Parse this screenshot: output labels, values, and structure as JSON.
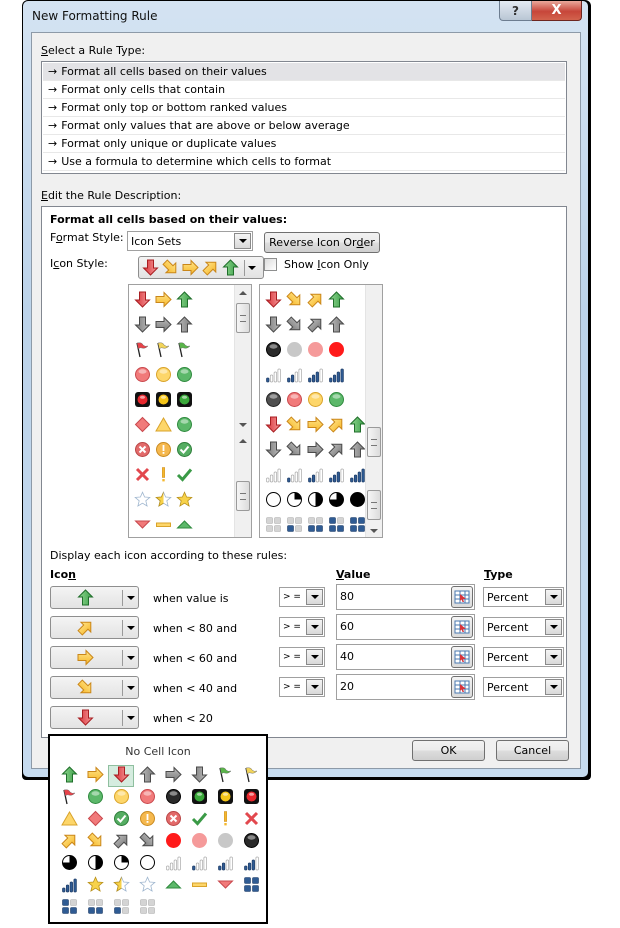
{
  "window": {
    "title": "New Formatting Rule",
    "help_label": "?",
    "close_label": "X"
  },
  "rule_type": {
    "heading_pre": "",
    "heading_u": "S",
    "heading_post": "elect a Rule Type:",
    "bullet": "→",
    "items": [
      {
        "label": "Format all cells based on their values",
        "selected": true
      },
      {
        "label": "Format only cells that contain",
        "selected": false
      },
      {
        "label": "Format only top or bottom ranked values",
        "selected": false
      },
      {
        "label": "Format only values that are above or below average",
        "selected": false
      },
      {
        "label": "Format only unique or duplicate values",
        "selected": false
      },
      {
        "label": "Use a formula to determine which cells to format",
        "selected": false
      }
    ]
  },
  "description": {
    "heading_u": "E",
    "heading_post": "dit the Rule Description:",
    "subheading": "Format all cells based on their values:",
    "format_style_pre": "F",
    "format_style_u": "o",
    "format_style_post": "rmat Style:",
    "format_style_value": "Icon Sets",
    "reverse_pre": "Reverse Icon Or",
    "reverse_u": "d",
    "reverse_post": "er",
    "icon_style_pre": "I",
    "icon_style_u": "c",
    "icon_style_post": "on Style:",
    "icon_style_value": [
      "arrow-down-red",
      "arrow-downright-yellow",
      "arrow-right-yellow",
      "arrow-upright-yellow",
      "arrow-up-green"
    ],
    "show_icon_only_pre": "Show ",
    "show_icon_only_u": "I",
    "show_icon_only_post": "con Only",
    "show_icon_only_checked": false,
    "gallery_left": [
      [
        "arrow-down-red",
        "arrow-right-yellow",
        "arrow-up-green"
      ],
      [
        "arrow-down-gray",
        "arrow-right-gray",
        "arrow-up-gray"
      ],
      [
        "flag-red",
        "flag-yellow",
        "flag-green"
      ],
      [
        "circle-red",
        "circle-yellow",
        "circle-green"
      ],
      [
        "light-red",
        "light-yellow",
        "light-green"
      ],
      [
        "diamond-red",
        "triangle-yellow",
        "circle-green"
      ],
      [
        "symbol-x-red",
        "symbol-excl-yellow",
        "symbol-check-green"
      ],
      [
        "x-red",
        "excl-yellow",
        "check-green"
      ],
      [
        "star-empty",
        "star-half",
        "star-full"
      ],
      [
        "tri-down-red",
        "dash-yellow",
        "tri-up-green"
      ]
    ],
    "gallery_right": [
      [
        "arrow-down-red",
        "arrow-downright-yellow",
        "arrow-upright-yellow",
        "arrow-up-green"
      ],
      [
        "arrow-down-gray",
        "arrow-downright-gray",
        "arrow-upright-gray",
        "arrow-up-gray"
      ],
      [
        "circle-black",
        "circle-gray",
        "circle-pink",
        "circle-brightred"
      ],
      [
        "bars-1",
        "bars-2",
        "bars-3",
        "bars-4"
      ],
      [
        "circle-darkgray",
        "circle-red",
        "circle-yellow",
        "circle-green"
      ],
      [
        "arrow-down-red",
        "arrow-downright-yellow",
        "arrow-right-yellow",
        "arrow-upright-yellow",
        "arrow-up-green"
      ],
      [
        "arrow-down-gray",
        "arrow-downright-gray",
        "arrow-right-gray",
        "arrow-upright-gray",
        "arrow-up-gray"
      ],
      [
        "bars-0",
        "bars-1",
        "bars-2",
        "bars-3",
        "bars-4"
      ],
      [
        "quarter-0",
        "quarter-1",
        "quarter-2",
        "quarter-3",
        "quarter-4"
      ],
      [
        "boxes-0",
        "boxes-1",
        "boxes-2",
        "boxes-3",
        "boxes-4"
      ]
    ],
    "display_rules_label": "Display each icon according to these rules:",
    "col_icon_pre": "Ico",
    "col_icon_u": "n",
    "col_value_u": "V",
    "col_value_post": "alue",
    "col_type_u": "T",
    "col_type_post": "ype",
    "rules": [
      {
        "icon": "arrow-up-green",
        "when": "when value is",
        "operator": ">=",
        "value": "80",
        "type": "Percent"
      },
      {
        "icon": "arrow-upright-yellow",
        "when": "when < 80 and",
        "operator": ">=",
        "value": "60",
        "type": "Percent"
      },
      {
        "icon": "arrow-right-yellow",
        "when": "when < 60 and",
        "operator": ">=",
        "value": "40",
        "type": "Percent"
      },
      {
        "icon": "arrow-downright-yellow",
        "when": "when < 40 and",
        "operator": ">=",
        "value": "20",
        "type": "Percent"
      },
      {
        "icon": "arrow-down-red",
        "when": "when < 20"
      }
    ]
  },
  "buttons": {
    "ok": "OK",
    "cancel": "Cancel"
  },
  "icon_picker": {
    "title": "No Cell Icon",
    "selected_index": 2,
    "icons": [
      "arrow-up-green",
      "arrow-right-yellow",
      "arrow-down-red",
      "arrow-up-gray",
      "arrow-right-gray",
      "arrow-down-gray",
      "flag-green",
      "flag-yellow",
      "flag-red",
      "circle-green",
      "circle-yellow",
      "circle-red",
      "circle-black",
      "light-green",
      "light-yellow",
      "light-red",
      "triangle-yellow",
      "diamond-red",
      "symbol-check-green",
      "symbol-excl-yellow",
      "symbol-x-red",
      "check-green",
      "excl-yellow",
      "x-red",
      "arrow-upright-yellow",
      "arrow-downright-yellow",
      "arrow-upright-gray",
      "arrow-downright-gray",
      "circle-brightred",
      "circle-pink",
      "circle-gray",
      "circle-black",
      "quarter-3",
      "quarter-2",
      "quarter-1",
      "quarter-0",
      "bars-0",
      "bars-1",
      "bars-2",
      "bars-3",
      "bars-4",
      "star-full",
      "star-half",
      "star-empty",
      "tri-up-green",
      "dash-yellow",
      "tri-down-red",
      "boxes-4",
      "boxes-3",
      "boxes-2",
      "boxes-1",
      "boxes-0"
    ]
  }
}
